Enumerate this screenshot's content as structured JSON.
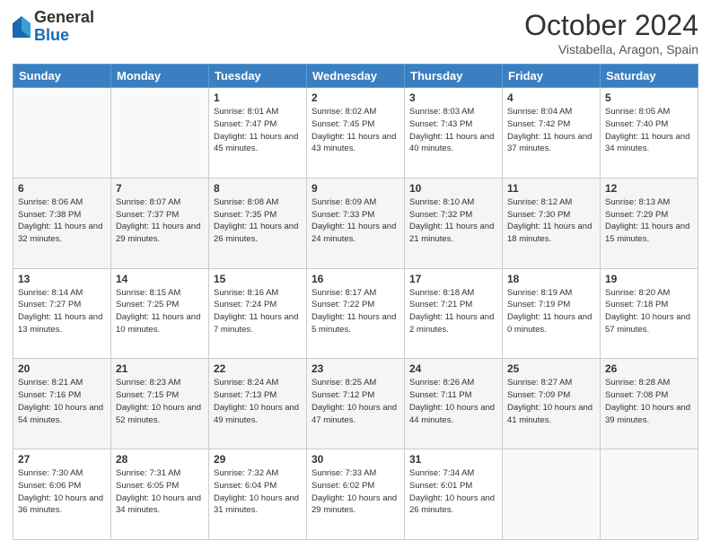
{
  "header": {
    "logo_general": "General",
    "logo_blue": "Blue",
    "month": "October 2024",
    "location": "Vistabella, Aragon, Spain"
  },
  "weekdays": [
    "Sunday",
    "Monday",
    "Tuesday",
    "Wednesday",
    "Thursday",
    "Friday",
    "Saturday"
  ],
  "weeks": [
    [
      {
        "day": "",
        "info": ""
      },
      {
        "day": "",
        "info": ""
      },
      {
        "day": "1",
        "info": "Sunrise: 8:01 AM\nSunset: 7:47 PM\nDaylight: 11 hours and 45 minutes."
      },
      {
        "day": "2",
        "info": "Sunrise: 8:02 AM\nSunset: 7:45 PM\nDaylight: 11 hours and 43 minutes."
      },
      {
        "day": "3",
        "info": "Sunrise: 8:03 AM\nSunset: 7:43 PM\nDaylight: 11 hours and 40 minutes."
      },
      {
        "day": "4",
        "info": "Sunrise: 8:04 AM\nSunset: 7:42 PM\nDaylight: 11 hours and 37 minutes."
      },
      {
        "day": "5",
        "info": "Sunrise: 8:05 AM\nSunset: 7:40 PM\nDaylight: 11 hours and 34 minutes."
      }
    ],
    [
      {
        "day": "6",
        "info": "Sunrise: 8:06 AM\nSunset: 7:38 PM\nDaylight: 11 hours and 32 minutes."
      },
      {
        "day": "7",
        "info": "Sunrise: 8:07 AM\nSunset: 7:37 PM\nDaylight: 11 hours and 29 minutes."
      },
      {
        "day": "8",
        "info": "Sunrise: 8:08 AM\nSunset: 7:35 PM\nDaylight: 11 hours and 26 minutes."
      },
      {
        "day": "9",
        "info": "Sunrise: 8:09 AM\nSunset: 7:33 PM\nDaylight: 11 hours and 24 minutes."
      },
      {
        "day": "10",
        "info": "Sunrise: 8:10 AM\nSunset: 7:32 PM\nDaylight: 11 hours and 21 minutes."
      },
      {
        "day": "11",
        "info": "Sunrise: 8:12 AM\nSunset: 7:30 PM\nDaylight: 11 hours and 18 minutes."
      },
      {
        "day": "12",
        "info": "Sunrise: 8:13 AM\nSunset: 7:29 PM\nDaylight: 11 hours and 15 minutes."
      }
    ],
    [
      {
        "day": "13",
        "info": "Sunrise: 8:14 AM\nSunset: 7:27 PM\nDaylight: 11 hours and 13 minutes."
      },
      {
        "day": "14",
        "info": "Sunrise: 8:15 AM\nSunset: 7:25 PM\nDaylight: 11 hours and 10 minutes."
      },
      {
        "day": "15",
        "info": "Sunrise: 8:16 AM\nSunset: 7:24 PM\nDaylight: 11 hours and 7 minutes."
      },
      {
        "day": "16",
        "info": "Sunrise: 8:17 AM\nSunset: 7:22 PM\nDaylight: 11 hours and 5 minutes."
      },
      {
        "day": "17",
        "info": "Sunrise: 8:18 AM\nSunset: 7:21 PM\nDaylight: 11 hours and 2 minutes."
      },
      {
        "day": "18",
        "info": "Sunrise: 8:19 AM\nSunset: 7:19 PM\nDaylight: 11 hours and 0 minutes."
      },
      {
        "day": "19",
        "info": "Sunrise: 8:20 AM\nSunset: 7:18 PM\nDaylight: 10 hours and 57 minutes."
      }
    ],
    [
      {
        "day": "20",
        "info": "Sunrise: 8:21 AM\nSunset: 7:16 PM\nDaylight: 10 hours and 54 minutes."
      },
      {
        "day": "21",
        "info": "Sunrise: 8:23 AM\nSunset: 7:15 PM\nDaylight: 10 hours and 52 minutes."
      },
      {
        "day": "22",
        "info": "Sunrise: 8:24 AM\nSunset: 7:13 PM\nDaylight: 10 hours and 49 minutes."
      },
      {
        "day": "23",
        "info": "Sunrise: 8:25 AM\nSunset: 7:12 PM\nDaylight: 10 hours and 47 minutes."
      },
      {
        "day": "24",
        "info": "Sunrise: 8:26 AM\nSunset: 7:11 PM\nDaylight: 10 hours and 44 minutes."
      },
      {
        "day": "25",
        "info": "Sunrise: 8:27 AM\nSunset: 7:09 PM\nDaylight: 10 hours and 41 minutes."
      },
      {
        "day": "26",
        "info": "Sunrise: 8:28 AM\nSunset: 7:08 PM\nDaylight: 10 hours and 39 minutes."
      }
    ],
    [
      {
        "day": "27",
        "info": "Sunrise: 7:30 AM\nSunset: 6:06 PM\nDaylight: 10 hours and 36 minutes."
      },
      {
        "day": "28",
        "info": "Sunrise: 7:31 AM\nSunset: 6:05 PM\nDaylight: 10 hours and 34 minutes."
      },
      {
        "day": "29",
        "info": "Sunrise: 7:32 AM\nSunset: 6:04 PM\nDaylight: 10 hours and 31 minutes."
      },
      {
        "day": "30",
        "info": "Sunrise: 7:33 AM\nSunset: 6:02 PM\nDaylight: 10 hours and 29 minutes."
      },
      {
        "day": "31",
        "info": "Sunrise: 7:34 AM\nSunset: 6:01 PM\nDaylight: 10 hours and 26 minutes."
      },
      {
        "day": "",
        "info": ""
      },
      {
        "day": "",
        "info": ""
      }
    ]
  ]
}
